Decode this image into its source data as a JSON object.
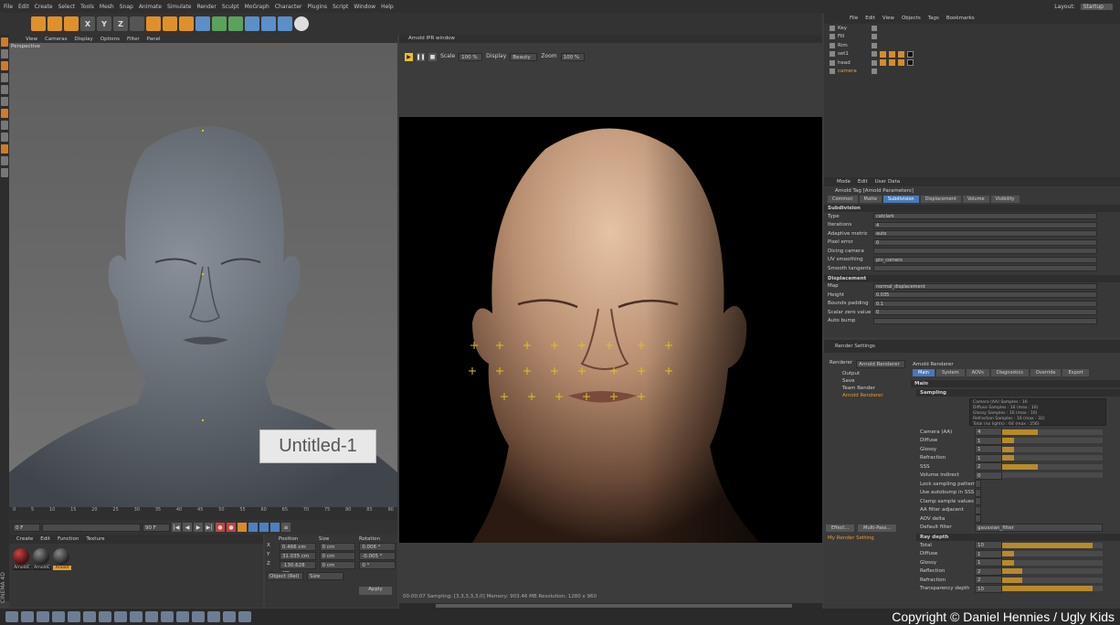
{
  "menubar": [
    "File",
    "Edit",
    "Create",
    "Select",
    "Tools",
    "Mesh",
    "Snap",
    "Animate",
    "Simulate",
    "Render",
    "Sculpt",
    "MoGraph",
    "Character",
    "Plugins",
    "Script",
    "Window",
    "Help"
  ],
  "layout": {
    "label": "Layout:",
    "value": "Startup"
  },
  "toolbar_icons": [
    "move",
    "scale",
    "rotate",
    "x-axis",
    "y-axis",
    "z-axis",
    "coord",
    "render-view",
    "render",
    "render-settings",
    "cube",
    "pen",
    "subdivide",
    "array",
    "camera",
    "floor",
    "light"
  ],
  "viewport": {
    "menu": [
      "View",
      "Cameras",
      "Display",
      "Options",
      "Filter",
      "Panel"
    ],
    "label": "Perspective",
    "tooltip": "Untitled-1"
  },
  "timeline": {
    "ticks": [
      "0",
      "5",
      "10",
      "15",
      "20",
      "25",
      "30",
      "35",
      "40",
      "45",
      "50",
      "55",
      "60",
      "65",
      "70",
      "75",
      "80",
      "85",
      "90"
    ],
    "start": "0 F",
    "end": "90 F"
  },
  "materials": {
    "menu": [
      "Create",
      "Edit",
      "Function",
      "Texture"
    ],
    "items": [
      {
        "label": "ArnoldC",
        "style": "red",
        "selected": false
      },
      {
        "label": "ArnoldC",
        "style": "dark",
        "selected": false
      },
      {
        "label": "Arnold",
        "style": "dark",
        "selected": true
      }
    ]
  },
  "coords": {
    "headers": [
      "Position",
      "Size",
      "Rotation"
    ],
    "rows": [
      {
        "axis": "X",
        "pos": "0.466 cm",
        "size": "0 cm",
        "rot": "H",
        "rotv": "0.006 °"
      },
      {
        "axis": "Y",
        "pos": "31.035 cm",
        "size": "0 cm",
        "rot": "P",
        "rotv": "-0.005 °"
      },
      {
        "axis": "Z",
        "pos": "-130.628 cm",
        "size": "0 cm",
        "rot": "B",
        "rotv": "0 °"
      }
    ],
    "mode1": "Object (Rel)",
    "mode2": "Size",
    "apply": "Apply"
  },
  "ipr": {
    "title": "Arnold IPR window",
    "scale_label": "Scale",
    "scale": "100 %",
    "display_label": "Display",
    "display": "Beauty",
    "zoom_label": "Zoom",
    "zoom": "100 %",
    "status": "00:00:07   Sampling: [3,3,3,3,3,0]   Memory: 903.46 MB   Resolution: 1280 x 960"
  },
  "objects": {
    "menu": [
      "File",
      "Edit",
      "View",
      "Objects",
      "Tags",
      "Bookmarks"
    ],
    "items": [
      {
        "name": "Key",
        "selected": false,
        "tags": 0
      },
      {
        "name": "Fill",
        "selected": false,
        "tags": 0
      },
      {
        "name": "Rim",
        "selected": false,
        "tags": 0
      },
      {
        "name": "set1",
        "selected": false,
        "tags": 4
      },
      {
        "name": "head",
        "selected": false,
        "tags": 4
      },
      {
        "name": "camera",
        "selected": true,
        "tags": 0
      }
    ]
  },
  "attributes": {
    "menu": [
      "Mode",
      "Edit",
      "User Data"
    ],
    "title": "Arnold Tag [Arnold Parameters]",
    "tabs": [
      "Common",
      "Matte",
      "Subdivision",
      "Displacement",
      "Volume",
      "Visibility"
    ],
    "active_tab": "Subdivision",
    "subdivision_title": "Subdivision",
    "subdivision": [
      {
        "label": "Type",
        "value": "catclark"
      },
      {
        "label": "Iterations",
        "value": "4"
      },
      {
        "label": "Adaptive metric",
        "value": "auto"
      },
      {
        "label": "Pixel error",
        "value": "0"
      },
      {
        "label": "Dicing camera",
        "value": ""
      },
      {
        "label": "UV smoothing",
        "value": "pin_corners"
      },
      {
        "label": "Smooth tangents",
        "value": ""
      }
    ],
    "displacement_title": "Displacement",
    "displacement": [
      {
        "label": "Map",
        "value": "normal_displacement"
      },
      {
        "label": "Height",
        "value": "0.035"
      },
      {
        "label": "Bounds padding",
        "value": "0.1"
      },
      {
        "label": "Scalar zero value",
        "value": "0"
      },
      {
        "label": "Auto bump",
        "value": ""
      }
    ]
  },
  "render_settings": {
    "bar": "Render Settings",
    "renderer_label": "Renderer",
    "renderer": "Arnold Renderer",
    "tree": [
      "Output",
      "Save",
      "Team Render",
      "Arnold Renderer"
    ],
    "buttons": [
      "Effect...",
      "Multi-Pass..."
    ],
    "my_setting": "My Render Setting",
    "header": "Arnold Renderer",
    "tabs": [
      "Main",
      "System",
      "AOVs",
      "Diagnostics",
      "Override",
      "Export"
    ],
    "main_label": "Main",
    "sampling_label": "Sampling",
    "info": [
      "Camera (AA) Samples : 16",
      "Diffuse Samples : 16 (max : 16)",
      "Glossy Samples : 16 (max : 16)",
      "Refraction Samples : 16 (max : 32)",
      "Total (no lights) : 64 (max : 256)"
    ],
    "samples": [
      {
        "label": "Camera (AA)",
        "value": "4",
        "fill": 0.35
      },
      {
        "label": "Diffuse",
        "value": "1",
        "fill": 0.12
      },
      {
        "label": "Glossy",
        "value": "1",
        "fill": 0.12
      },
      {
        "label": "Refraction",
        "value": "1",
        "fill": 0.12
      },
      {
        "label": "SSS",
        "value": "2",
        "fill": 0.35
      },
      {
        "label": "Volume indirect",
        "value": "0",
        "fill": 0
      }
    ],
    "options": [
      "Lock sampling pattern",
      "Use autobump in SSS",
      "Clamp sample values",
      "AA filter adjacent",
      "AOV delta"
    ],
    "filter_label": "Default filter",
    "filter": "gaussian_filter",
    "ray_depth_label": "Ray depth",
    "ray": [
      {
        "label": "Total",
        "value": "10",
        "fill": 0.9
      },
      {
        "label": "Diffuse",
        "value": "1",
        "fill": 0.12
      },
      {
        "label": "Glossy",
        "value": "1",
        "fill": 0.12
      },
      {
        "label": "Reflection",
        "value": "2",
        "fill": 0.2
      },
      {
        "label": "Refraction",
        "value": "2",
        "fill": 0.2
      },
      {
        "label": "Transparency depth",
        "value": "10",
        "fill": 0.9
      }
    ]
  },
  "brand_vertical": "CINEMA 4D",
  "copyright": "Copyright © Daniel Hennies / Ugly Kids"
}
